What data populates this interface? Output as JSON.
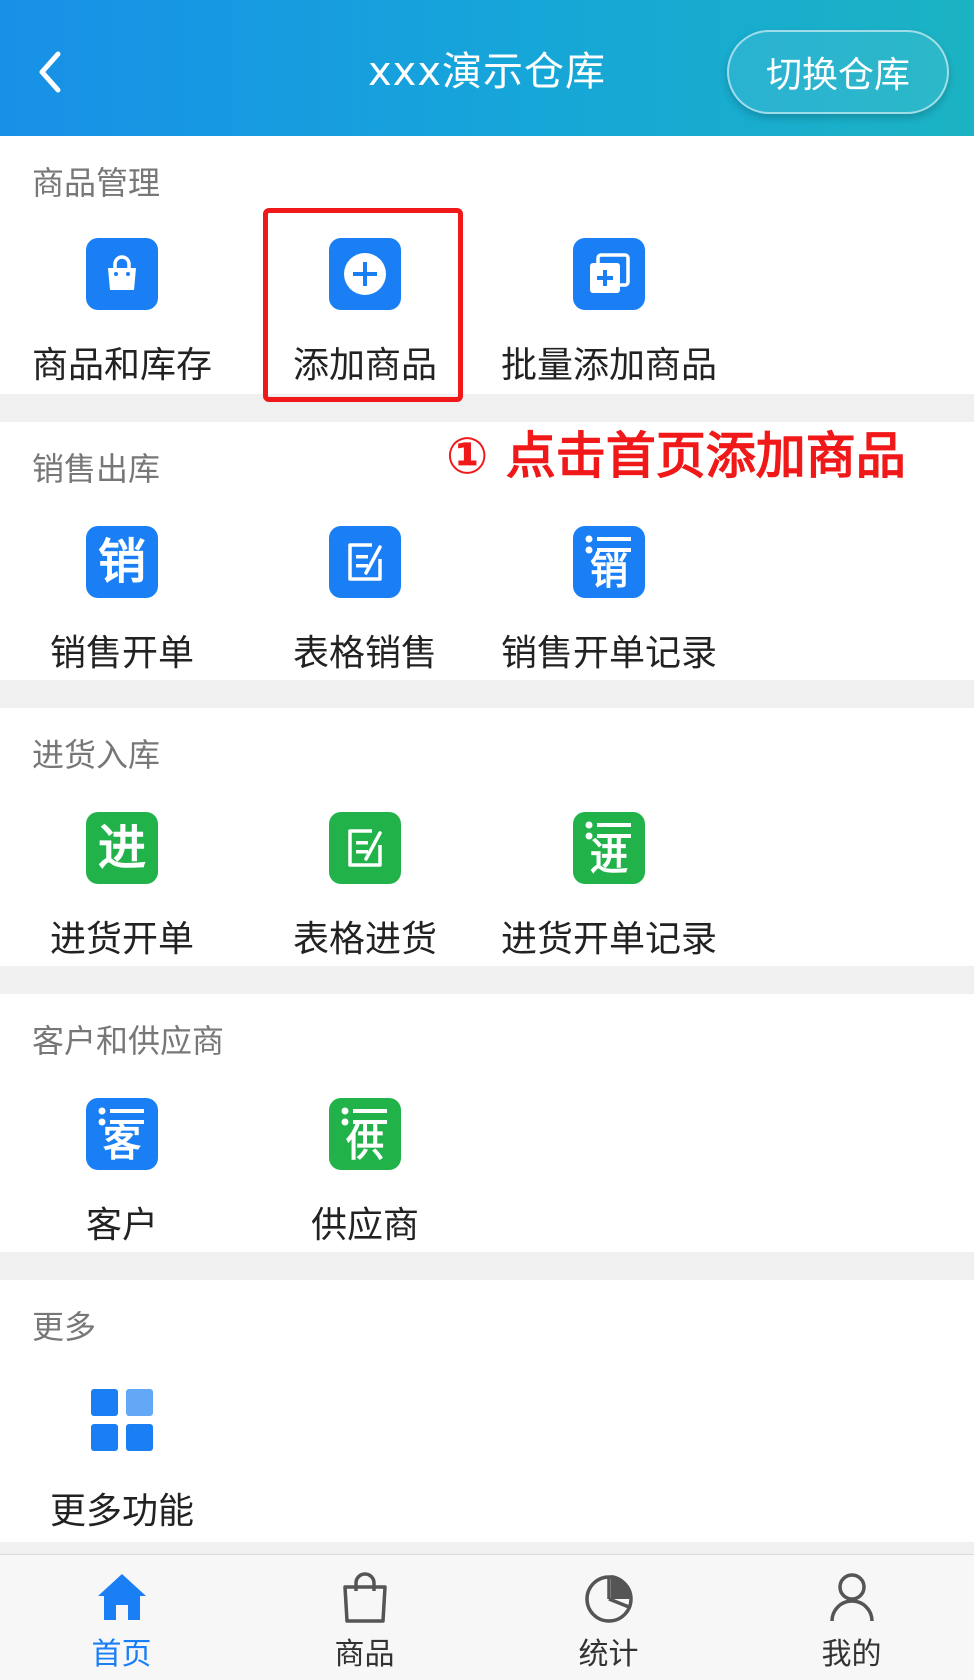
{
  "header": {
    "title": "xxx演示仓库",
    "switch_label": "切换仓库"
  },
  "sections": {
    "goods": {
      "title": "商品管理",
      "items": [
        {
          "label": "商品和库存",
          "icon": "shopping-bag-icon"
        },
        {
          "label": "添加商品",
          "icon": "plus-circle-icon"
        },
        {
          "label": "批量添加商品",
          "icon": "batch-add-icon"
        }
      ]
    },
    "sales": {
      "title": "销售出库",
      "items": [
        {
          "label": "销售开单",
          "icon_text": "销"
        },
        {
          "label": "表格销售",
          "icon": "table-edit-icon"
        },
        {
          "label": "销售开单记录",
          "icon_text": "销"
        }
      ]
    },
    "purchase": {
      "title": "进货入库",
      "items": [
        {
          "label": "进货开单",
          "icon_text": "进"
        },
        {
          "label": "表格进货",
          "icon": "table-edit-icon"
        },
        {
          "label": "进货开单记录",
          "icon_text": "进"
        }
      ]
    },
    "partners": {
      "title": "客户和供应商",
      "items": [
        {
          "label": "客户",
          "icon_text": "客"
        },
        {
          "label": "供应商",
          "icon_text": "供"
        }
      ]
    },
    "more": {
      "title": "更多",
      "items": [
        {
          "label": "更多功能",
          "icon": "grid-icon"
        }
      ]
    }
  },
  "annotation": {
    "text": "① 点击首页添加商品"
  },
  "bottom_nav": {
    "items": [
      {
        "label": "首页",
        "icon": "home-icon",
        "active": true
      },
      {
        "label": "商品",
        "icon": "bag-icon"
      },
      {
        "label": "统计",
        "icon": "pie-chart-icon"
      },
      {
        "label": "我的",
        "icon": "user-icon"
      }
    ]
  },
  "colors": {
    "primary_blue": "#1a7ff5",
    "green": "#21b24a",
    "annotation_red": "#f01818",
    "header_gradient_start": "#1890e8",
    "header_gradient_end": "#1bb3c3"
  }
}
